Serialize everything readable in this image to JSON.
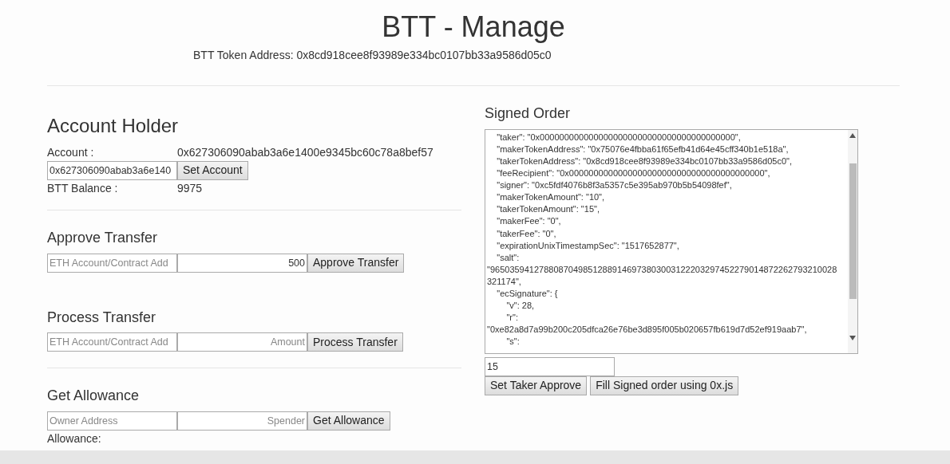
{
  "title": "BTT - Manage",
  "token_address": "BTT Token Address: 0x8cd918cee8f93989e334bc0107bb33a9586d05c0",
  "account_holder": {
    "heading": "Account Holder",
    "account_label": "Account :",
    "account_value": "0x627306090abab3a6e1400e9345bc60c78a8bef57",
    "account_input": "0x627306090abab3a6e140",
    "set_button": "Set Account",
    "balance_label": "BTT Balance :",
    "balance_value": "9975"
  },
  "sections": [
    {
      "heading": "Approve Transfer",
      "field_1": {
        "placeholder": "ETH Account/Contract Add"
      },
      "field_2": {
        "value": "500"
      },
      "button": "Approve Transfer"
    },
    {
      "heading": "Process Transfer",
      "field_1": {
        "placeholder": "ETH Account/Contract Add"
      },
      "field_2": {
        "placeholder": "Amount"
      },
      "button": "Process Transfer"
    },
    {
      "heading": "Get Allowance",
      "field_1": {
        "placeholder": "Owner Address"
      },
      "field_2": {
        "placeholder": "Spender"
      },
      "button": "Get Allowance",
      "result": "Allowance:"
    }
  ],
  "signed_order": {
    "heading": "Signed Order",
    "lines": [
      "    \"taker\": \"0x0000000000000000000000000000000000000000\",",
      "    \"makerTokenAddress\": \"0x75076e4fbba61f65efb41d64e45cff340b1e518a\",",
      "    \"takerTokenAddress\": \"0x8cd918cee8f93989e334bc0107bb33a9586d05c0\",",
      "    \"feeRecipient\": \"0x0000000000000000000000000000000000000000\",",
      "    \"signer\": \"0xc5fdf4076b8f3a5357c5e395ab970b5b54098fef\",",
      "    \"makerTokenAmount\": \"10\",",
      "    \"takerTokenAmount\": \"15\",",
      "    \"makerFee\": \"0\",",
      "    \"takerFee\": \"0\",",
      "    \"expirationUnixTimestampSec\": \"1517652877\",",
      "    \"salt\":",
      "\"96503594127880870498512889146973803003122203297452279014872262793210028",
      "321174\",",
      "    \"ecSignature\": {",
      "        \"v\": 28,",
      "        \"r\":",
      "\"0xe82a8d7a99b200c205dfca26e76be3d895f005b020657fb619d7d52ef919aab7\",",
      "        \"s\":"
    ],
    "amount_input": "15",
    "buttons": [
      "Set Taker Approve",
      "Fill Signed order using 0x.js"
    ]
  }
}
